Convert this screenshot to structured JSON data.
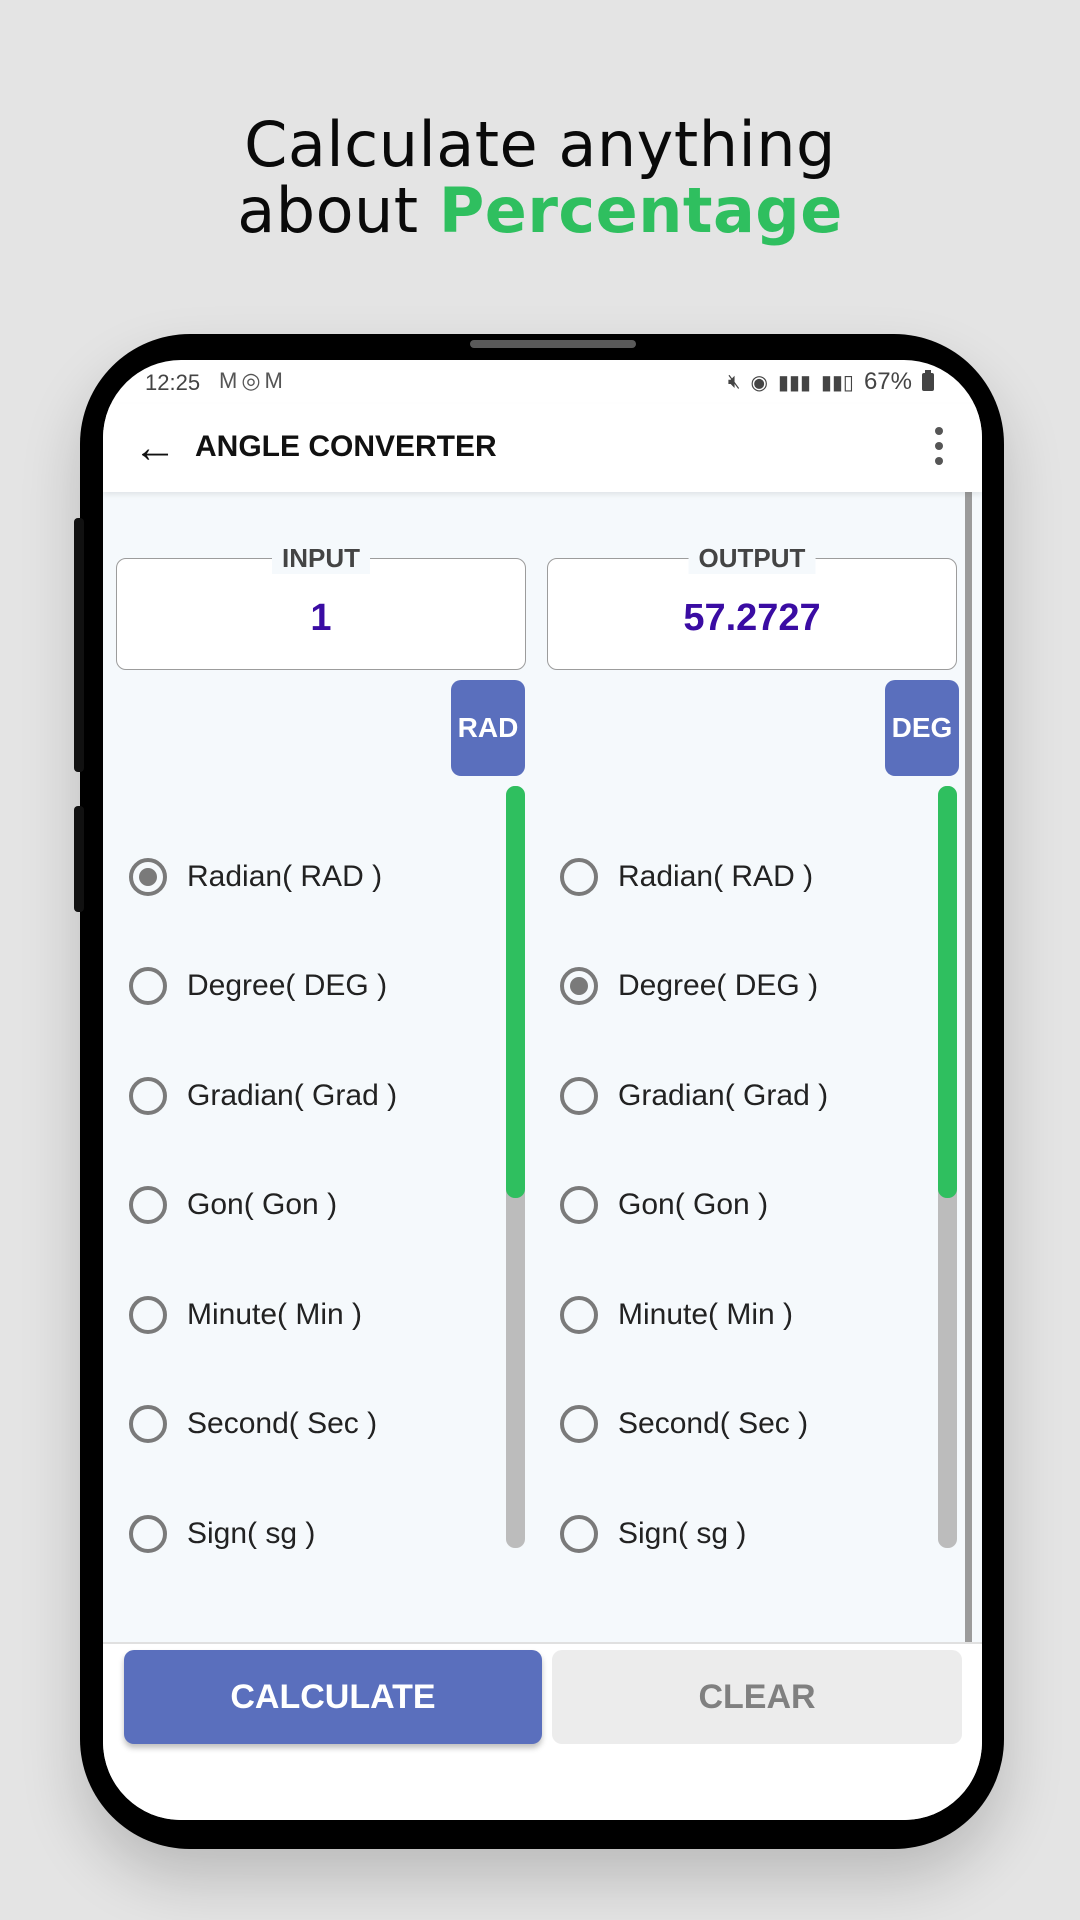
{
  "promo": {
    "line1": "Calculate anything",
    "line2_prefix": "about ",
    "line2_accent": "Percentage"
  },
  "status_bar": {
    "time": "12:25",
    "notifications": "M◎M",
    "battery": "67%"
  },
  "appbar": {
    "title": "ANGLE CONVERTER"
  },
  "input": {
    "label": "INPUT",
    "value": "1",
    "unit": "RAD"
  },
  "output": {
    "label": "OUTPUT",
    "value": "57.2727",
    "unit": "DEG"
  },
  "units": [
    "Radian( RAD )",
    "Degree( DEG )",
    "Gradian( Grad )",
    "Gon( Gon )",
    "Minute( Min )",
    "Second( Sec )",
    "Sign( sg )"
  ],
  "selected": {
    "input": "Radian( RAD )",
    "output": "Degree( DEG )"
  },
  "buttons": {
    "calculate": "CALCULATE",
    "clear": "CLEAR"
  },
  "colors": {
    "accent_green": "#2fbf5f",
    "primary": "#5a6fbd",
    "value_text": "#3a0ca3"
  }
}
